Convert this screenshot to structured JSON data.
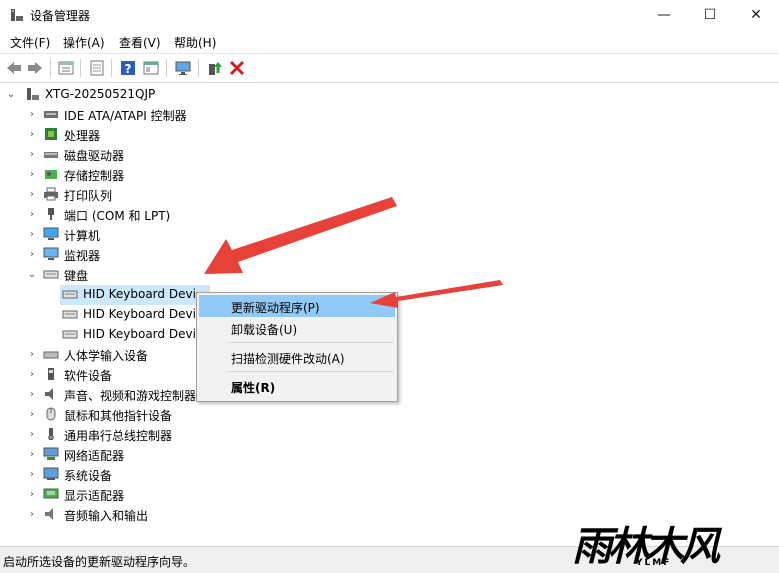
{
  "window": {
    "title": "设备管理器",
    "minimize": "—",
    "maximize": "☐",
    "close": "✕"
  },
  "menu": [
    "文件(F)",
    "操作(A)",
    "查看(V)",
    "帮助(H)"
  ],
  "tree": {
    "root": "XTG-20250521QJP",
    "categories": [
      "IDE ATA/ATAPI 控制器",
      "处理器",
      "磁盘驱动器",
      "存储控制器",
      "打印队列",
      "端口 (COM 和 LPT)",
      "计算机",
      "监视器",
      "键盘",
      "人体学输入设备",
      "软件设备",
      "声音、视频和游戏控制器",
      "鼠标和其他指针设备",
      "通用串行总线控制器",
      "网络适配器",
      "系统设备",
      "显示适配器",
      "音频输入和输出"
    ],
    "keyboard_children": [
      "HID Keyboard Devi",
      "HID Keyboard Devi",
      "HID Keyboard Devi"
    ]
  },
  "context_menu": {
    "update": "更新驱动程序(P)",
    "uninstall": "卸载设备(U)",
    "scan": "扫描检测硬件改动(A)",
    "properties": "属性(R)"
  },
  "status": "启动所选设备的更新驱动程序向导。",
  "watermark": {
    "main": "雨林木风",
    "sub": "YLMF"
  },
  "colors": {
    "highlight": "#91c9f7",
    "arrow": "#e8413a",
    "selection": "#cce8ff"
  }
}
